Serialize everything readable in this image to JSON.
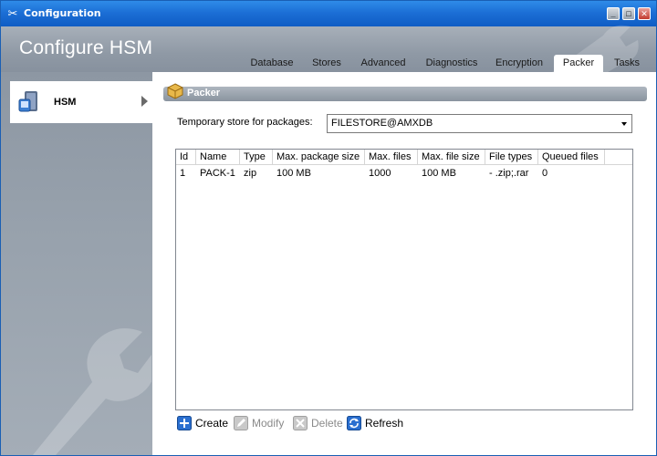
{
  "window": {
    "title": "Configuration"
  },
  "header": {
    "title": "Configure HSM"
  },
  "tabs": [
    {
      "label": "Database"
    },
    {
      "label": "Stores"
    },
    {
      "label": "Advanced"
    },
    {
      "label": "Diagnostics"
    },
    {
      "label": "Encryption"
    },
    {
      "label": "Packer",
      "active": true
    },
    {
      "label": "Tasks"
    }
  ],
  "sidebar": {
    "items": [
      {
        "label": "HSM"
      }
    ]
  },
  "section": {
    "title": "Packer"
  },
  "store": {
    "label": "Temporary store for packages:",
    "value": "FILESTORE@AMXDB"
  },
  "table": {
    "columns": [
      "Id",
      "Name",
      "Type",
      "Max. package size",
      "Max. files",
      "Max. file size",
      "File types",
      "Queued files"
    ],
    "rows": [
      [
        "1",
        "PACK-1",
        "zip",
        "100 MB",
        "1000",
        "100 MB",
        "- .zip;.rar",
        "0"
      ]
    ]
  },
  "toolbar": {
    "create": "Create",
    "modify": "Modify",
    "delete": "Delete",
    "refresh": "Refresh"
  },
  "colors": {
    "titlebar": "#1c6fd6",
    "sidebar": "#97a1ac",
    "accent_blue": "#2a6fd0"
  }
}
